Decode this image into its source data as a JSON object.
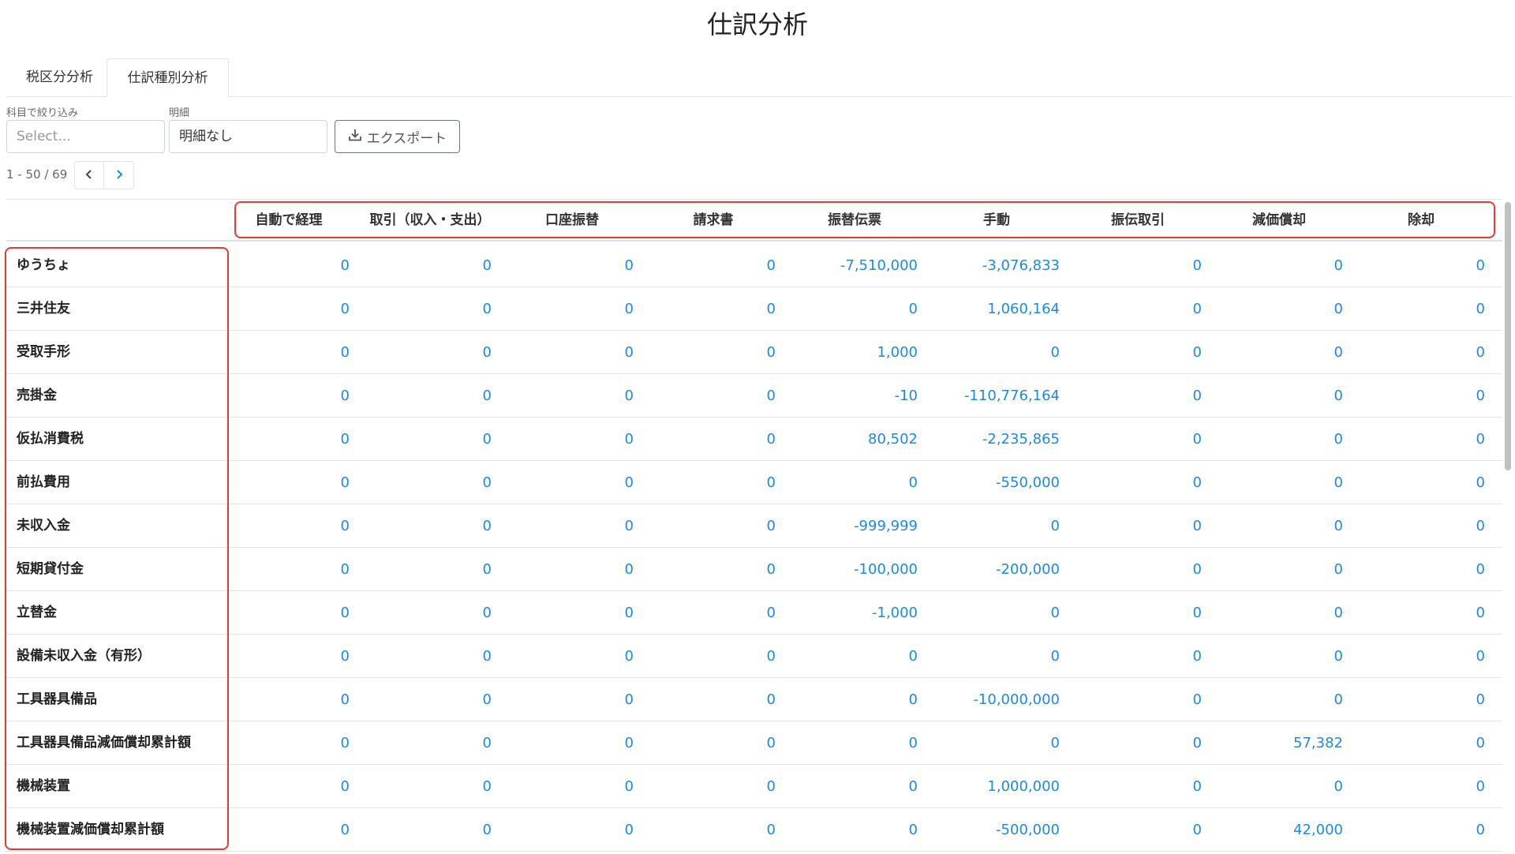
{
  "page": {
    "title": "仕訳分析"
  },
  "tabs": [
    {
      "label": "税区分分析"
    },
    {
      "label": "仕訳種別分析"
    }
  ],
  "filters": {
    "account_label": "科目で絞り込み",
    "account_placeholder": "Select...",
    "detail_label": "明細",
    "detail_value": "明細なし",
    "export_label": "エクスポート"
  },
  "pagination": {
    "text": "1 - 50 / 69"
  },
  "table": {
    "columns": [
      "自動で経理",
      "取引（収入・支出）",
      "口座振替",
      "請求書",
      "振替伝票",
      "手動",
      "振伝取引",
      "減価償却",
      "除却"
    ],
    "rows": [
      {
        "label": "ゆうちょ",
        "values": [
          "0",
          "0",
          "0",
          "0",
          "-7,510,000",
          "-3,076,833",
          "0",
          "0",
          "0"
        ]
      },
      {
        "label": "三井住友",
        "values": [
          "0",
          "0",
          "0",
          "0",
          "0",
          "1,060,164",
          "0",
          "0",
          "0"
        ]
      },
      {
        "label": "受取手形",
        "values": [
          "0",
          "0",
          "0",
          "0",
          "1,000",
          "0",
          "0",
          "0",
          "0"
        ]
      },
      {
        "label": "売掛金",
        "values": [
          "0",
          "0",
          "0",
          "0",
          "-10",
          "-110,776,164",
          "0",
          "0",
          "0"
        ]
      },
      {
        "label": "仮払消費税",
        "values": [
          "0",
          "0",
          "0",
          "0",
          "80,502",
          "-2,235,865",
          "0",
          "0",
          "0"
        ]
      },
      {
        "label": "前払費用",
        "values": [
          "0",
          "0",
          "0",
          "0",
          "0",
          "-550,000",
          "0",
          "0",
          "0"
        ]
      },
      {
        "label": "未収入金",
        "values": [
          "0",
          "0",
          "0",
          "0",
          "-999,999",
          "0",
          "0",
          "0",
          "0"
        ]
      },
      {
        "label": "短期貸付金",
        "values": [
          "0",
          "0",
          "0",
          "0",
          "-100,000",
          "-200,000",
          "0",
          "0",
          "0"
        ]
      },
      {
        "label": "立替金",
        "values": [
          "0",
          "0",
          "0",
          "0",
          "-1,000",
          "0",
          "0",
          "0",
          "0"
        ]
      },
      {
        "label": "設備未収入金（有形）",
        "values": [
          "0",
          "0",
          "0",
          "0",
          "0",
          "0",
          "0",
          "0",
          "0"
        ]
      },
      {
        "label": "工具器具備品",
        "values": [
          "0",
          "0",
          "0",
          "0",
          "0",
          "-10,000,000",
          "0",
          "0",
          "0"
        ]
      },
      {
        "label": "工具器具備品減価償却累計額",
        "values": [
          "0",
          "0",
          "0",
          "0",
          "0",
          "0",
          "0",
          "57,382",
          "0"
        ]
      },
      {
        "label": "機械装置",
        "values": [
          "0",
          "0",
          "0",
          "0",
          "0",
          "1,000,000",
          "0",
          "0",
          "0"
        ]
      },
      {
        "label": "機械装置減価償却累計額",
        "values": [
          "0",
          "0",
          "0",
          "0",
          "0",
          "-500,000",
          "0",
          "42,000",
          "0"
        ]
      }
    ]
  },
  "colors": {
    "link": "#1e88e5",
    "highlight": "#e53935"
  },
  "icons": {
    "export": "download-icon",
    "prev": "chevron-left-icon",
    "next": "chevron-right-icon"
  }
}
